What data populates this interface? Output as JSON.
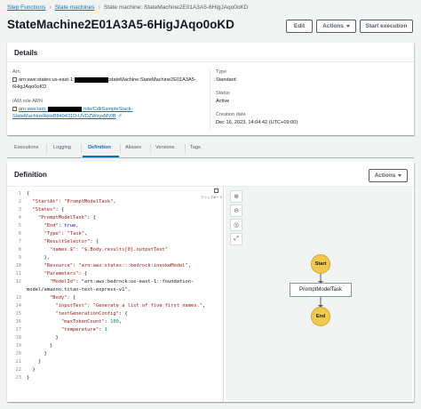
{
  "breadcrumb": {
    "step_functions": "Step Functions",
    "state_machines": "State machines",
    "current": "State machine: StateMachine2E01A3A5-6HigJAqo0oKD"
  },
  "title": "StateMachine2E01A3A5-6HigJAqo0oKD",
  "buttons": {
    "edit": "Edit",
    "actions": "Actions",
    "start": "Start execution"
  },
  "details": {
    "heading": "Details",
    "arn_label": "Arn",
    "arn_prefix": "arn:aws:states:us-east-1:",
    "arn_suffix": ":stateMachine:StateMachine2E01A3A5-",
    "arn_line2": "6HigJAqo0oKD",
    "iam_label": "IAM role ARN",
    "iam_prefix": "arn:aws:iam::",
    "iam_mid": ":role/CdkSampleStack-",
    "iam_line2": "StateMachineRoleB840431D-UVDZWsyxMVIB",
    "type_label": "Type",
    "type_value": "Standard",
    "status_label": "Status",
    "status_value": "Active",
    "created_label": "Creation date",
    "created_value": "Dec 16, 2023, 14:04:42 (UTC+09:00)"
  },
  "tabs": [
    "Executions",
    "Logging",
    "Definition",
    "Aliases",
    "Versions",
    "Tags"
  ],
  "active_tab": "Definition",
  "definition": {
    "heading": "Definition",
    "actions": "Actions",
    "copy_hint": "クリップボード",
    "code_lines": [
      "{",
      "  \"StartAt\": \"PromptModelTask\",",
      "  \"States\": {",
      "    \"PromptModelTask\": {",
      "      \"End\": true,",
      "      \"Type\": \"Task\",",
      "      \"ResultSelector\": {",
      "        \"names.$\": \"$.Body.results[0].outputText\"",
      "      },",
      "      \"Resource\": \"arn:aws:states:::bedrock:invokeModel\",",
      "      \"Parameters\": {",
      "        \"ModelId\": \"arn:aws:bedrock:us-east-1::foundation-",
      "model/amazon.titan-text-express-v1\",",
      "        \"Body\": {",
      "          \"inputText\": \"Generate a list of five first names.\",",
      "          \"textGenerationConfig\": {",
      "            \"maxTokenCount\": 100,",
      "            \"temperature\": 1",
      "          }",
      "        }",
      "      }",
      "    }",
      "  }",
      "}"
    ],
    "line_numbers": [
      "1",
      "2",
      "3",
      "4",
      "5",
      "6",
      "7",
      "8",
      "9",
      "10",
      "11",
      "12",
      "",
      "13",
      "14",
      "15",
      "16",
      "17",
      "18",
      "19",
      "20",
      "21",
      "22",
      "23"
    ]
  },
  "graph": {
    "start": "Start",
    "task": "PromptModelTask",
    "end": "End",
    "tools": [
      "zoom-in-icon",
      "zoom-out-icon",
      "center-icon",
      "fit-icon"
    ]
  },
  "colors": {
    "link": "#0073bb",
    "start_node": "#f2c94c",
    "accent": "#ec7211"
  }
}
